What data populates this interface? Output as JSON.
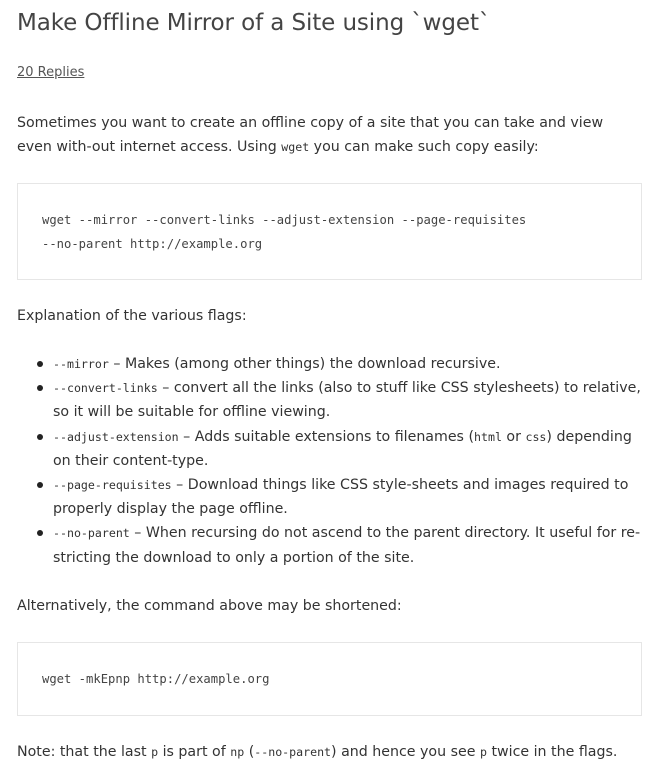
{
  "post": {
    "title": "Make Offline Mirror of a Site using `wget`",
    "replies": "20 Replies",
    "intro_before": "Sometimes you want to create an offline copy of a site that you can take and view even with-out internet access. Using ",
    "intro_code": "wget",
    "intro_after": " you can make such copy easily:",
    "code1_line1": "wget --mirror --convert-links --adjust-extension --page-requisites",
    "code1_line2": "--no-parent http://example.org",
    "explain": "Explanation of the various flags:",
    "flags": [
      {
        "flag": "--mirror",
        "text": " – Makes (among other things) the download recursive."
      },
      {
        "flag": "--convert-links",
        "text": " – convert all the links (also to stuff like CSS stylesheets) to relative, so it will be suitable for offline viewing."
      },
      {
        "flag": "--adjust-extension",
        "text_before": " – Adds suitable extensions to filenames (",
        "code_a": "html",
        "text_mid": " or ",
        "code_b": "css",
        "text_after": ") depending on their content-type."
      },
      {
        "flag": "--page-requisites",
        "text": " – Download things like CSS style-sheets and images required to properly display the page offline."
      },
      {
        "flag": "--no-parent",
        "text": " – When recursing do not ascend to the parent directory. It useful for re-stricting the download to only a portion of the site."
      }
    ],
    "alt": "Alternatively, the command above may be shortened:",
    "code2_line1": "wget -mkEpnp http://example.org",
    "note_1": "Note: that the last ",
    "note_code_p1": "p",
    "note_2": " is part of ",
    "note_code_np": "np",
    "note_3": " (",
    "note_code_noparent": "--no-parent",
    "note_4": ") and hence you see ",
    "note_code_p2": "p",
    "note_5": " twice in the flags."
  }
}
